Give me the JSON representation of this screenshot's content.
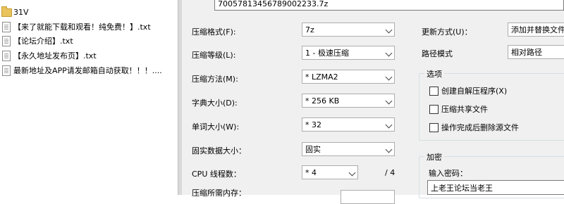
{
  "files": [
    {
      "type": "folder",
      "icon": "folder-icon",
      "name": "31V"
    },
    {
      "type": "file",
      "icon": "text-file-icon",
      "name": "【来了就能下载和观看！纯免费！】.txt"
    },
    {
      "type": "file",
      "icon": "text-file-icon",
      "name": "【论坛介绍】.txt"
    },
    {
      "type": "file",
      "icon": "text-file-icon",
      "name": "【永久地址发布页】.txt"
    },
    {
      "type": "file",
      "icon": "text-file-icon",
      "name": "最新地址及APP请发邮箱自动获取！！！...."
    }
  ],
  "archive": {
    "name_value": "7005781345678900223​3.7z"
  },
  "options": {
    "format": {
      "label": "压缩格式(F):",
      "value": "7z"
    },
    "level": {
      "label": "压缩等级(L):",
      "value": "1 - 极速压缩"
    },
    "method": {
      "label": "压缩方法(M):",
      "value": "* LZMA2"
    },
    "dict": {
      "label": "字典大小(D):",
      "value": "* 256 KB"
    },
    "word": {
      "label": "单词大小(W):",
      "value": "* 32"
    },
    "solid": {
      "label": "固实数据大小：",
      "value": "固实"
    },
    "threads": {
      "label": "CPU 线程数：",
      "value": "* 4",
      "total": "/ 4"
    },
    "memory": {
      "label": "压缩所需内存："
    }
  },
  "right_panel": {
    "update_mode": {
      "label": "更新方式(U)：",
      "value": "添加并替换文件"
    },
    "path_mode": {
      "label": "路径模式",
      "value": "相对路径"
    },
    "options_group": {
      "title": "选项",
      "checkboxes": [
        {
          "label": "创建自解压程序(X)",
          "checked": false
        },
        {
          "label": "压缩共享文件",
          "checked": false
        },
        {
          "label": "操作完成后删除源文件",
          "checked": false
        }
      ]
    },
    "encryption_group": {
      "title": "加密",
      "password_label": "输入密码：",
      "password_value": "上老王论坛当老王"
    }
  }
}
